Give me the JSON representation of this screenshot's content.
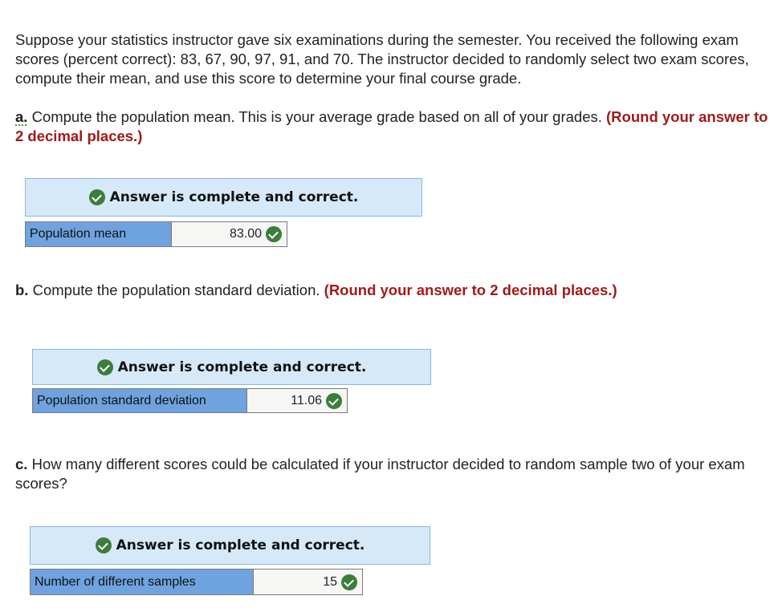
{
  "intro": "Suppose your statistics instructor gave six examinations during the semester. You received the following exam scores (percent correct): 83, 67, 90, 97, 91, and 70. The instructor decided to randomly select two exam scores, compute their mean, and use this score to determine your final course grade.",
  "parts": [
    {
      "marker": "a.",
      "question": "Compute the population mean. This is your average grade based on all of your grades.",
      "instruction": "(Round your answer to 2 decimal places.)",
      "status": "Answer is complete and correct.",
      "label": "Population mean",
      "value": "83.00",
      "result_icon": "check-circle-icon"
    },
    {
      "marker": "b.",
      "question": "Compute the population standard deviation.",
      "instruction": "(Round your answer to 2 decimal places.)",
      "status": "Answer is complete and correct.",
      "label": "Population standard deviation",
      "value": "11.06",
      "result_icon": "check-circle-icon"
    },
    {
      "marker": "c.",
      "question": "How many different scores could be calculated if your instructor decided to random sample two of your exam scores?",
      "instruction": "",
      "status": "Answer is complete and correct.",
      "label": "Number of different samples",
      "value": "15",
      "result_icon": "check-circle-icon"
    }
  ],
  "colors": {
    "instruction": "#a11a1a",
    "banner_bg": "#d6e9f8",
    "label_cell_bg": "#6fa3df",
    "check_green": "#3b7d3b"
  }
}
